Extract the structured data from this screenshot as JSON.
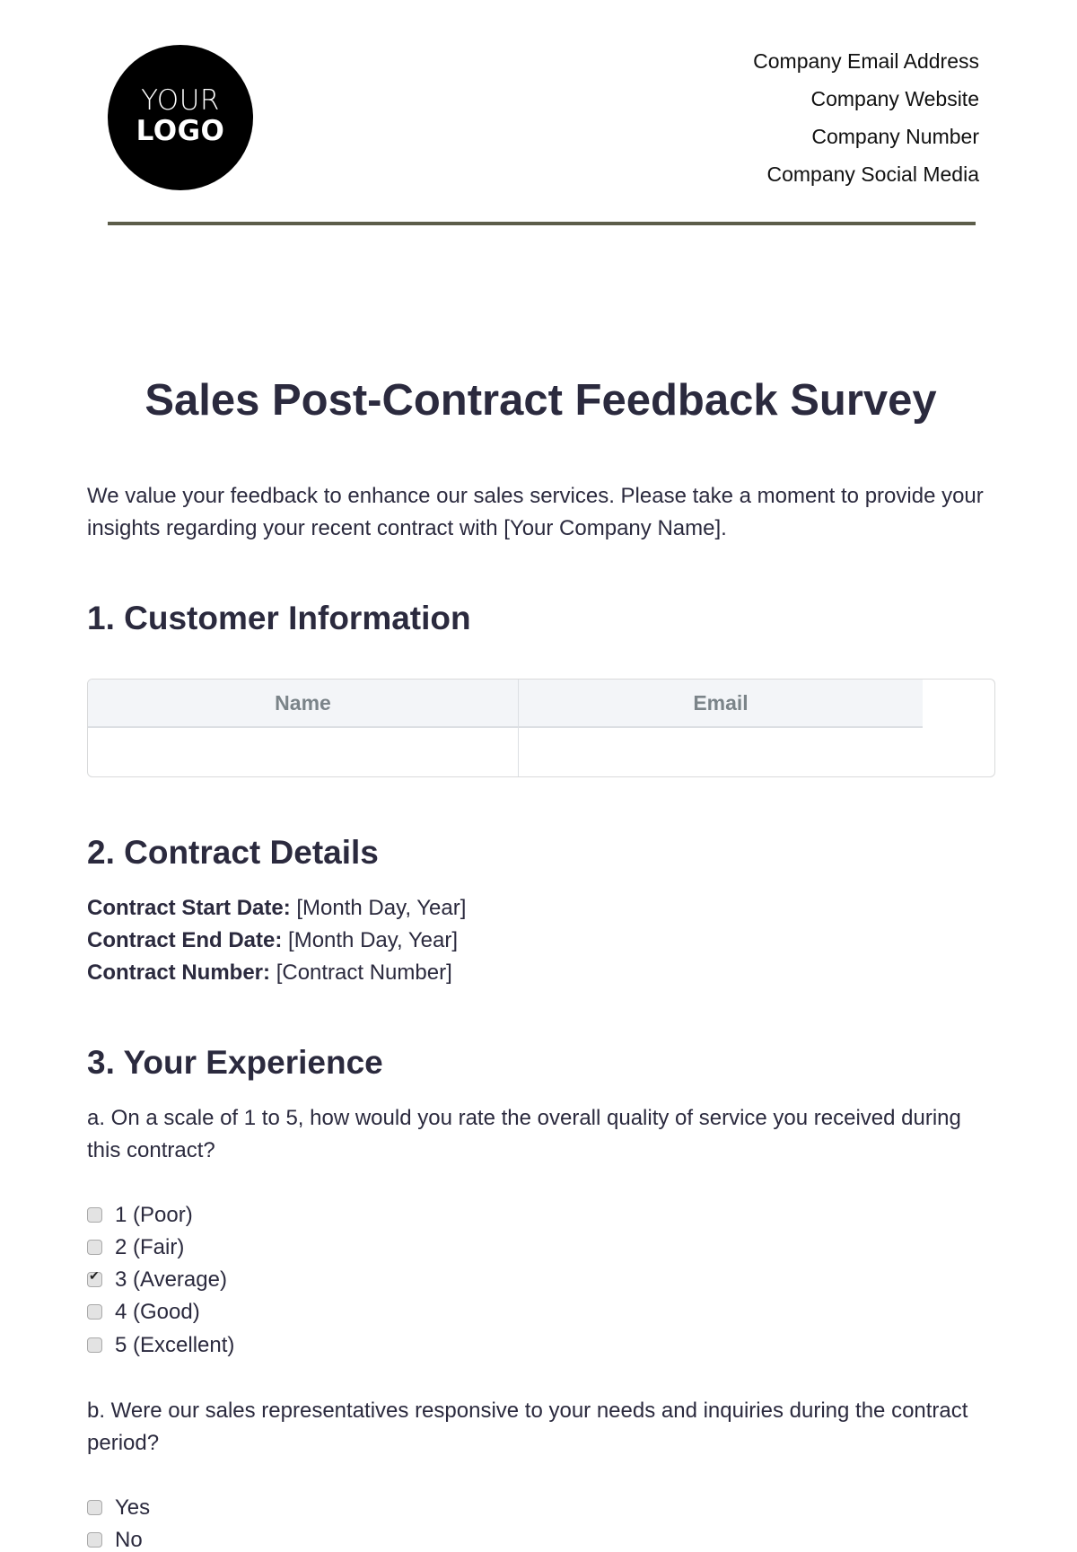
{
  "header": {
    "logo": {
      "line1": "YOUR",
      "line2": "LOGO"
    },
    "contact": [
      "Company Email Address",
      "Company Website",
      "Company Number",
      "Company Social Media"
    ]
  },
  "title": "Sales Post-Contract Feedback Survey",
  "intro": "We value your feedback to enhance our sales services. Please take a moment to provide your insights regarding your recent contract with [Your Company Name].",
  "sections": {
    "customer": {
      "heading": "1. Customer Information",
      "table": {
        "columns": [
          "Name",
          "Email"
        ],
        "rows": [
          [
            "",
            ""
          ]
        ]
      }
    },
    "contract": {
      "heading": "2. Contract Details",
      "fields": [
        {
          "label": "Contract Start Date:",
          "value": "[Month Day, Year]"
        },
        {
          "label": "Contract End Date:",
          "value": "[Month Day, Year]"
        },
        {
          "label": "Contract Number:",
          "value": "[Contract Number]"
        }
      ]
    },
    "experience": {
      "heading": "3. Your Experience",
      "question_a": {
        "text": "a. On a scale of 1 to 5, how would you rate the overall quality of service you received during this contract?",
        "options": [
          {
            "label": "1 (Poor)",
            "checked": false
          },
          {
            "label": "2 (Fair)",
            "checked": false
          },
          {
            "label": "3 (Average)",
            "checked": true
          },
          {
            "label": "4 (Good)",
            "checked": false
          },
          {
            "label": "5 (Excellent)",
            "checked": false
          }
        ]
      },
      "question_b": {
        "text": "b. Were our sales representatives responsive to your needs and inquiries during the contract period?",
        "options": [
          {
            "label": "Yes",
            "checked": false
          },
          {
            "label": "No",
            "checked": false
          }
        ]
      }
    }
  }
}
